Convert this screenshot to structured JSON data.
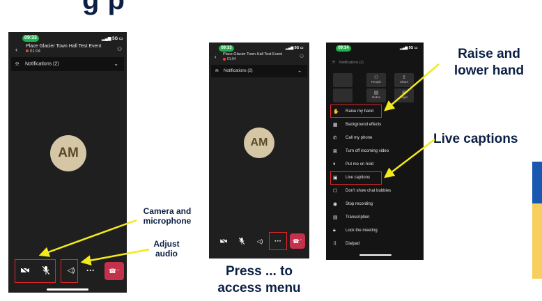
{
  "slide": {
    "title": "g                      p"
  },
  "phone1": {
    "time": "09:33",
    "signal": "5G",
    "meeting_title": "Place Glacier Town Hall Test Event",
    "meeting_time": "01:04",
    "notifications": "Notifications (2)",
    "avatar": "AM"
  },
  "phone2": {
    "time": "09:33",
    "signal": "5G",
    "meeting_title": "Place Glacier Town Hall Test Event",
    "meeting_time": "01:04",
    "notifications": "Notifications (2)",
    "avatar": "AM"
  },
  "phone3": {
    "time": "09:34",
    "signal": "5G",
    "notifications": "Notifications (2)",
    "grid": [
      {
        "label": "",
        "icon": "blank"
      },
      {
        "label": "People",
        "icon": "people-icon"
      },
      {
        "label": "Share",
        "icon": "share-icon"
      },
      {
        "label": "",
        "icon": "blank"
      },
      {
        "label": "Notes",
        "icon": "notes-icon"
      },
      {
        "label": "Apps",
        "icon": "apps-icon"
      }
    ],
    "menu": [
      {
        "label": "Raise my hand",
        "icon": "hand-icon"
      },
      {
        "label": "Background effects",
        "icon": "background-icon"
      },
      {
        "label": "Call my phone",
        "icon": "phone-icon"
      },
      {
        "label": "Turn off incoming video",
        "icon": "video-off-icon"
      },
      {
        "label": "Put me on hold",
        "icon": "pause-icon"
      },
      {
        "label": "Live captions",
        "icon": "captions-icon"
      },
      {
        "label": "Don't show chat bubbles",
        "icon": "chat-icon"
      },
      {
        "label": "Stop recording",
        "icon": "record-icon"
      },
      {
        "label": "Transcription",
        "icon": "transcript-icon"
      },
      {
        "label": "Lock the meeting",
        "icon": "lock-icon"
      },
      {
        "label": "Dialpad",
        "icon": "dialpad-icon"
      }
    ]
  },
  "callouts": {
    "camera_mic": "Camera and microphone",
    "adjust_audio": "Adjust audio",
    "press_menu": "Press ... to access menu",
    "raise_hand": "Raise and lower hand",
    "live_captions": "Live captions"
  },
  "colors": {
    "highlight": "#e0262b",
    "arrow": "#f2ea1a",
    "navy": "#0b1f44",
    "hangup": "#c4314b",
    "status_green": "#22b14c",
    "banner_blue": "#1a57b0",
    "banner_yellow": "#f6cf5c"
  }
}
